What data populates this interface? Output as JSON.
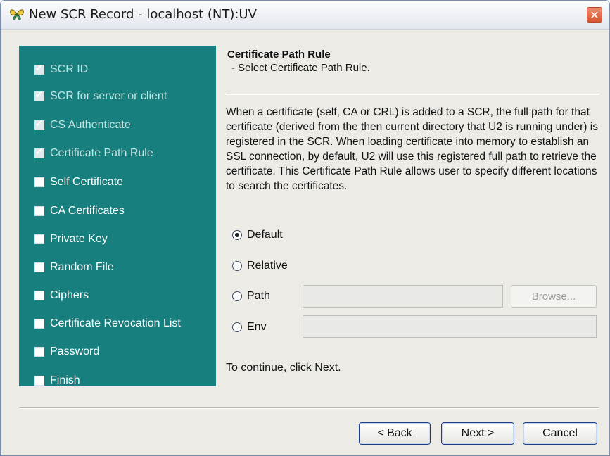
{
  "window": {
    "title": "New SCR Record - localhost (NT):UV",
    "close_glyph": "✕",
    "app_icon": "butterfly-app-icon"
  },
  "steps": [
    {
      "label": "SCR ID",
      "checked": true
    },
    {
      "label": "SCR for server or client",
      "checked": true
    },
    {
      "label": "CS Authenticate",
      "checked": true
    },
    {
      "label": "Certificate Path Rule",
      "checked": true
    },
    {
      "label": "Self Certificate",
      "checked": false
    },
    {
      "label": "CA Certificates",
      "checked": false
    },
    {
      "label": "Private Key",
      "checked": false
    },
    {
      "label": "Random File",
      "checked": false
    },
    {
      "label": "Ciphers",
      "checked": false
    },
    {
      "label": "Certificate Revocation List",
      "checked": false
    },
    {
      "label": "Password",
      "checked": false
    },
    {
      "label": "Finish",
      "checked": false
    }
  ],
  "content": {
    "title": "Certificate Path Rule",
    "subtitle": "- Select Certificate Path Rule.",
    "description": "When a certificate (self, CA or CRL) is added to a SCR, the full path for that certificate (derived from the then current directory that U2 is running under) is registered in the SCR. When loading certificate into memory to establish an SSL connection, by default, U2 will use this registered full path to retrieve the certificate. This Certificate Path Rule allows user to specify different locations to search the certificates.",
    "options": {
      "default": {
        "label": "Default",
        "selected": true
      },
      "relative": {
        "label": "Relative",
        "selected": false
      },
      "path": {
        "label": "Path",
        "selected": false,
        "value": ""
      },
      "env": {
        "label": "Env",
        "selected": false,
        "value": ""
      }
    },
    "browse_label": "Browse...",
    "continue_text": "To continue, click Next."
  },
  "buttons": {
    "back": "< Back",
    "next": "Next >",
    "cancel": "Cancel"
  },
  "colors": {
    "steps_panel": "#177f7e",
    "button_border": "#1d3e86"
  }
}
